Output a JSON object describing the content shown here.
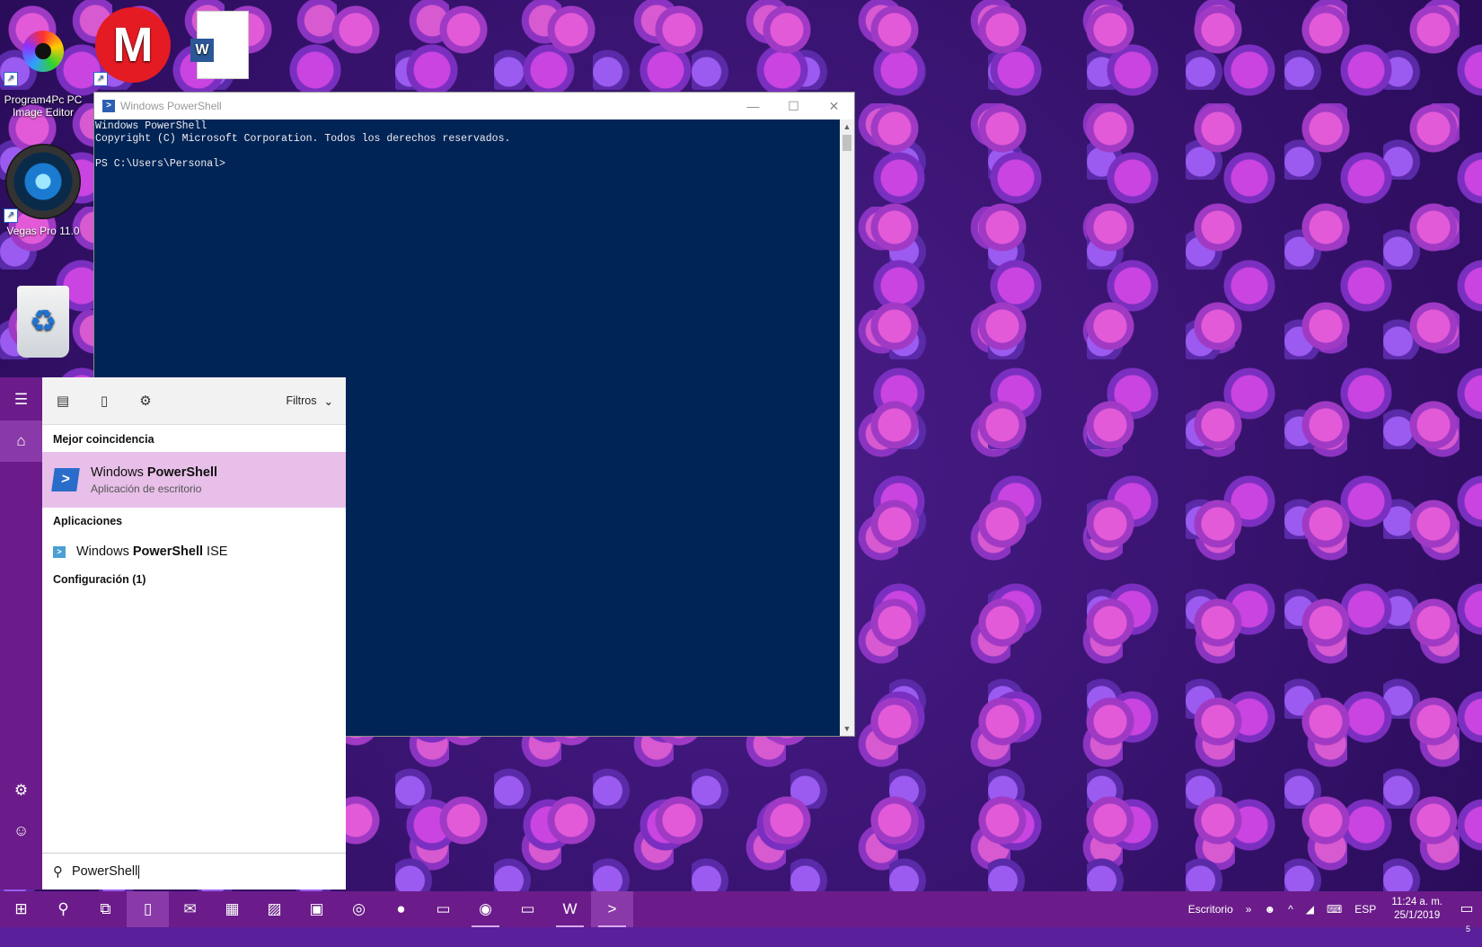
{
  "desktop": {
    "icons": [
      {
        "label": "Program4Pc PC Image Editor",
        "icon": "color-wheel-icon"
      },
      {
        "label": "",
        "icon": "mega-icon"
      },
      {
        "label": "",
        "icon": "word-document-icon"
      },
      {
        "label": "Vegas Pro 11.0",
        "icon": "camera-lens-icon"
      },
      {
        "label": "",
        "icon": "recycle-bin-icon"
      }
    ]
  },
  "powershell": {
    "title": "Windows PowerShell",
    "console_lines": [
      "Windows PowerShell",
      "Copyright (C) Microsoft Corporation. Todos los derechos reservados.",
      "",
      "PS C:\\Users\\Personal>"
    ],
    "console_bg": "#012456"
  },
  "start": {
    "filters_label": "Filtros",
    "best_match_header": "Mejor coincidencia",
    "best_match": {
      "title_prefix": "Windows ",
      "title_bold": "PowerShell",
      "subtitle": "Aplicación de escritorio"
    },
    "apps_header": "Aplicaciones",
    "app_item": {
      "prefix": "Windows ",
      "bold": "PowerShell",
      "suffix": " ISE"
    },
    "settings_header": "Configuración (1)",
    "search_value": "PowerShell",
    "highlight_color": "#e8bfe9"
  },
  "taskbar": {
    "tray_label": "Escritorio",
    "language": "ESP",
    "time": "11:24 a. m.",
    "date": "25/1/2019",
    "notification_count": "5",
    "accent": "#6b1c8a"
  }
}
